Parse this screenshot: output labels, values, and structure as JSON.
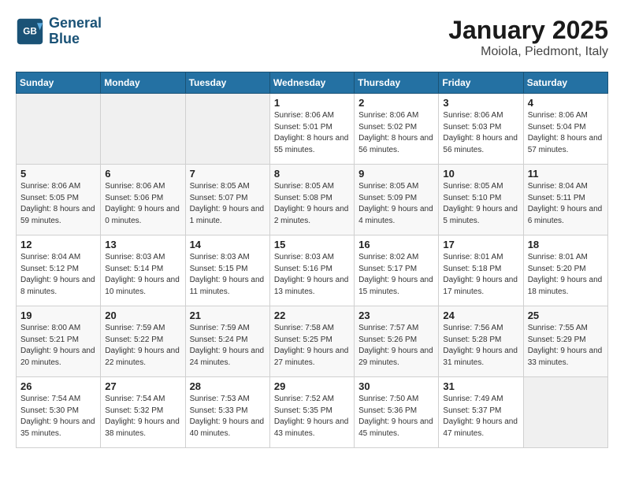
{
  "logo": {
    "line1": "General",
    "line2": "Blue"
  },
  "title": "January 2025",
  "location": "Moiola, Piedmont, Italy",
  "weekdays": [
    "Sunday",
    "Monday",
    "Tuesday",
    "Wednesday",
    "Thursday",
    "Friday",
    "Saturday"
  ],
  "weeks": [
    [
      {
        "day": "",
        "sunrise": "",
        "sunset": "",
        "daylight": "",
        "empty": true
      },
      {
        "day": "",
        "sunrise": "",
        "sunset": "",
        "daylight": "",
        "empty": true
      },
      {
        "day": "",
        "sunrise": "",
        "sunset": "",
        "daylight": "",
        "empty": true
      },
      {
        "day": "1",
        "sunrise": "Sunrise: 8:06 AM",
        "sunset": "Sunset: 5:01 PM",
        "daylight": "Daylight: 8 hours and 55 minutes."
      },
      {
        "day": "2",
        "sunrise": "Sunrise: 8:06 AM",
        "sunset": "Sunset: 5:02 PM",
        "daylight": "Daylight: 8 hours and 56 minutes."
      },
      {
        "day": "3",
        "sunrise": "Sunrise: 8:06 AM",
        "sunset": "Sunset: 5:03 PM",
        "daylight": "Daylight: 8 hours and 56 minutes."
      },
      {
        "day": "4",
        "sunrise": "Sunrise: 8:06 AM",
        "sunset": "Sunset: 5:04 PM",
        "daylight": "Daylight: 8 hours and 57 minutes."
      }
    ],
    [
      {
        "day": "5",
        "sunrise": "Sunrise: 8:06 AM",
        "sunset": "Sunset: 5:05 PM",
        "daylight": "Daylight: 8 hours and 59 minutes."
      },
      {
        "day": "6",
        "sunrise": "Sunrise: 8:06 AM",
        "sunset": "Sunset: 5:06 PM",
        "daylight": "Daylight: 9 hours and 0 minutes."
      },
      {
        "day": "7",
        "sunrise": "Sunrise: 8:05 AM",
        "sunset": "Sunset: 5:07 PM",
        "daylight": "Daylight: 9 hours and 1 minute."
      },
      {
        "day": "8",
        "sunrise": "Sunrise: 8:05 AM",
        "sunset": "Sunset: 5:08 PM",
        "daylight": "Daylight: 9 hours and 2 minutes."
      },
      {
        "day": "9",
        "sunrise": "Sunrise: 8:05 AM",
        "sunset": "Sunset: 5:09 PM",
        "daylight": "Daylight: 9 hours and 4 minutes."
      },
      {
        "day": "10",
        "sunrise": "Sunrise: 8:05 AM",
        "sunset": "Sunset: 5:10 PM",
        "daylight": "Daylight: 9 hours and 5 minutes."
      },
      {
        "day": "11",
        "sunrise": "Sunrise: 8:04 AM",
        "sunset": "Sunset: 5:11 PM",
        "daylight": "Daylight: 9 hours and 6 minutes."
      }
    ],
    [
      {
        "day": "12",
        "sunrise": "Sunrise: 8:04 AM",
        "sunset": "Sunset: 5:12 PM",
        "daylight": "Daylight: 9 hours and 8 minutes."
      },
      {
        "day": "13",
        "sunrise": "Sunrise: 8:03 AM",
        "sunset": "Sunset: 5:14 PM",
        "daylight": "Daylight: 9 hours and 10 minutes."
      },
      {
        "day": "14",
        "sunrise": "Sunrise: 8:03 AM",
        "sunset": "Sunset: 5:15 PM",
        "daylight": "Daylight: 9 hours and 11 minutes."
      },
      {
        "day": "15",
        "sunrise": "Sunrise: 8:03 AM",
        "sunset": "Sunset: 5:16 PM",
        "daylight": "Daylight: 9 hours and 13 minutes."
      },
      {
        "day": "16",
        "sunrise": "Sunrise: 8:02 AM",
        "sunset": "Sunset: 5:17 PM",
        "daylight": "Daylight: 9 hours and 15 minutes."
      },
      {
        "day": "17",
        "sunrise": "Sunrise: 8:01 AM",
        "sunset": "Sunset: 5:18 PM",
        "daylight": "Daylight: 9 hours and 17 minutes."
      },
      {
        "day": "18",
        "sunrise": "Sunrise: 8:01 AM",
        "sunset": "Sunset: 5:20 PM",
        "daylight": "Daylight: 9 hours and 18 minutes."
      }
    ],
    [
      {
        "day": "19",
        "sunrise": "Sunrise: 8:00 AM",
        "sunset": "Sunset: 5:21 PM",
        "daylight": "Daylight: 9 hours and 20 minutes."
      },
      {
        "day": "20",
        "sunrise": "Sunrise: 7:59 AM",
        "sunset": "Sunset: 5:22 PM",
        "daylight": "Daylight: 9 hours and 22 minutes."
      },
      {
        "day": "21",
        "sunrise": "Sunrise: 7:59 AM",
        "sunset": "Sunset: 5:24 PM",
        "daylight": "Daylight: 9 hours and 24 minutes."
      },
      {
        "day": "22",
        "sunrise": "Sunrise: 7:58 AM",
        "sunset": "Sunset: 5:25 PM",
        "daylight": "Daylight: 9 hours and 27 minutes."
      },
      {
        "day": "23",
        "sunrise": "Sunrise: 7:57 AM",
        "sunset": "Sunset: 5:26 PM",
        "daylight": "Daylight: 9 hours and 29 minutes."
      },
      {
        "day": "24",
        "sunrise": "Sunrise: 7:56 AM",
        "sunset": "Sunset: 5:28 PM",
        "daylight": "Daylight: 9 hours and 31 minutes."
      },
      {
        "day": "25",
        "sunrise": "Sunrise: 7:55 AM",
        "sunset": "Sunset: 5:29 PM",
        "daylight": "Daylight: 9 hours and 33 minutes."
      }
    ],
    [
      {
        "day": "26",
        "sunrise": "Sunrise: 7:54 AM",
        "sunset": "Sunset: 5:30 PM",
        "daylight": "Daylight: 9 hours and 35 minutes."
      },
      {
        "day": "27",
        "sunrise": "Sunrise: 7:54 AM",
        "sunset": "Sunset: 5:32 PM",
        "daylight": "Daylight: 9 hours and 38 minutes."
      },
      {
        "day": "28",
        "sunrise": "Sunrise: 7:53 AM",
        "sunset": "Sunset: 5:33 PM",
        "daylight": "Daylight: 9 hours and 40 minutes."
      },
      {
        "day": "29",
        "sunrise": "Sunrise: 7:52 AM",
        "sunset": "Sunset: 5:35 PM",
        "daylight": "Daylight: 9 hours and 43 minutes."
      },
      {
        "day": "30",
        "sunrise": "Sunrise: 7:50 AM",
        "sunset": "Sunset: 5:36 PM",
        "daylight": "Daylight: 9 hours and 45 minutes."
      },
      {
        "day": "31",
        "sunrise": "Sunrise: 7:49 AM",
        "sunset": "Sunset: 5:37 PM",
        "daylight": "Daylight: 9 hours and 47 minutes."
      },
      {
        "day": "",
        "sunrise": "",
        "sunset": "",
        "daylight": "",
        "empty": true
      }
    ]
  ]
}
